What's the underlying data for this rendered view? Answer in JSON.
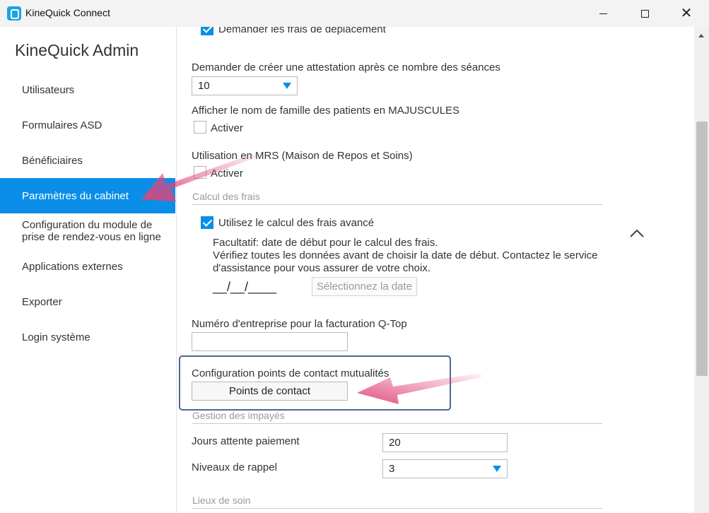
{
  "window": {
    "title": "KineQuick Connect"
  },
  "sidebar": {
    "title": "KineQuick Admin",
    "items": [
      {
        "label": "Utilisateurs"
      },
      {
        "label": "Formulaires ASD"
      },
      {
        "label": "Bénéficiaires"
      },
      {
        "label": "Paramètres du cabinet",
        "active": true
      },
      {
        "label_line1": "Configuration du module de",
        "label_line2": "prise de rendez-vous en ligne"
      },
      {
        "label": "Applications externes"
      },
      {
        "label": "Exporter"
      },
      {
        "label": "Login système"
      }
    ]
  },
  "content": {
    "travel_costs": {
      "label": "Demander les frais de déplacement",
      "checked": true
    },
    "attestation": {
      "label": "Demander de créer une attestation après ce nombre des séances",
      "value": "10"
    },
    "uppercase": {
      "label": "Afficher le nom de famille des patients en MAJUSCULES",
      "checkbox_label": "Activer",
      "checked": false
    },
    "mrs": {
      "label": "Utilisation en MRS (Maison de Repos et Soins)",
      "checkbox_label": "Activer",
      "checked": false
    },
    "fees_section": {
      "title": "Calcul des frais",
      "advanced": {
        "label": "Utilisez le calcul des frais avancé",
        "checked": true
      },
      "info_line1": "Facultatif: date de début pour le calcul des frais.",
      "info_line2": "Vérifiez toutes les données avant de choisir la date de début. Contactez le service",
      "info_line3": "d'assistance pour vous assurer de votre choix.",
      "date_placeholder": "__/__/____",
      "select_date_button": "Sélectionnez la date"
    },
    "company_number": {
      "label": "Numéro d'entreprise pour la facturation Q-Top",
      "value": ""
    },
    "contact_points": {
      "label": "Configuration points de contact mutualités",
      "button": "Points de contact"
    },
    "unpaid_section": {
      "title": "Gestion des impayés",
      "wait_days": {
        "label": "Jours attente paiement",
        "value": "20"
      },
      "reminder_levels": {
        "label": "Niveaux de rappel",
        "value": "3"
      }
    },
    "care_places_section": {
      "title": "Lieux de soin"
    }
  },
  "colors": {
    "accent": "#0a8ee8",
    "arrow": "#e0457a",
    "highlight_border": "#4a6a8f"
  }
}
